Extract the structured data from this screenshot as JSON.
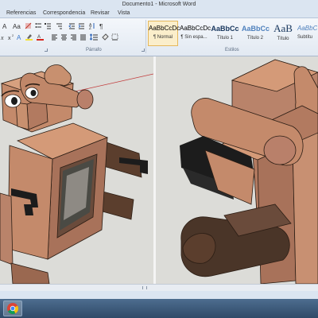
{
  "window": {
    "title": "Documento1 - Microsoft Word"
  },
  "ribbon_tabs": [
    "Referencias",
    "Correspondencia",
    "Revisar",
    "Vista"
  ],
  "groups": {
    "paragraph": "Párrafo",
    "styles": "Estilos"
  },
  "styles": [
    {
      "sample": "AaBbCcDc",
      "name": "¶ Normal"
    },
    {
      "sample": "AaBbCcDc",
      "name": "¶ Sin espa..."
    },
    {
      "sample": "AaBbCc",
      "name": "Título 1"
    },
    {
      "sample": "AaBbCc",
      "name": "Título 2"
    },
    {
      "sample": "AaB",
      "name": "Título"
    },
    {
      "sample": "AaBbCc",
      "name": "Subtítu"
    }
  ],
  "colors": {
    "highlight": "#f5e33a",
    "font_color": "#d7261e",
    "model_skin": "#c98f6e",
    "model_dark": "#4a3528"
  },
  "taskbar": {
    "app_icon": "chrome-icon"
  }
}
